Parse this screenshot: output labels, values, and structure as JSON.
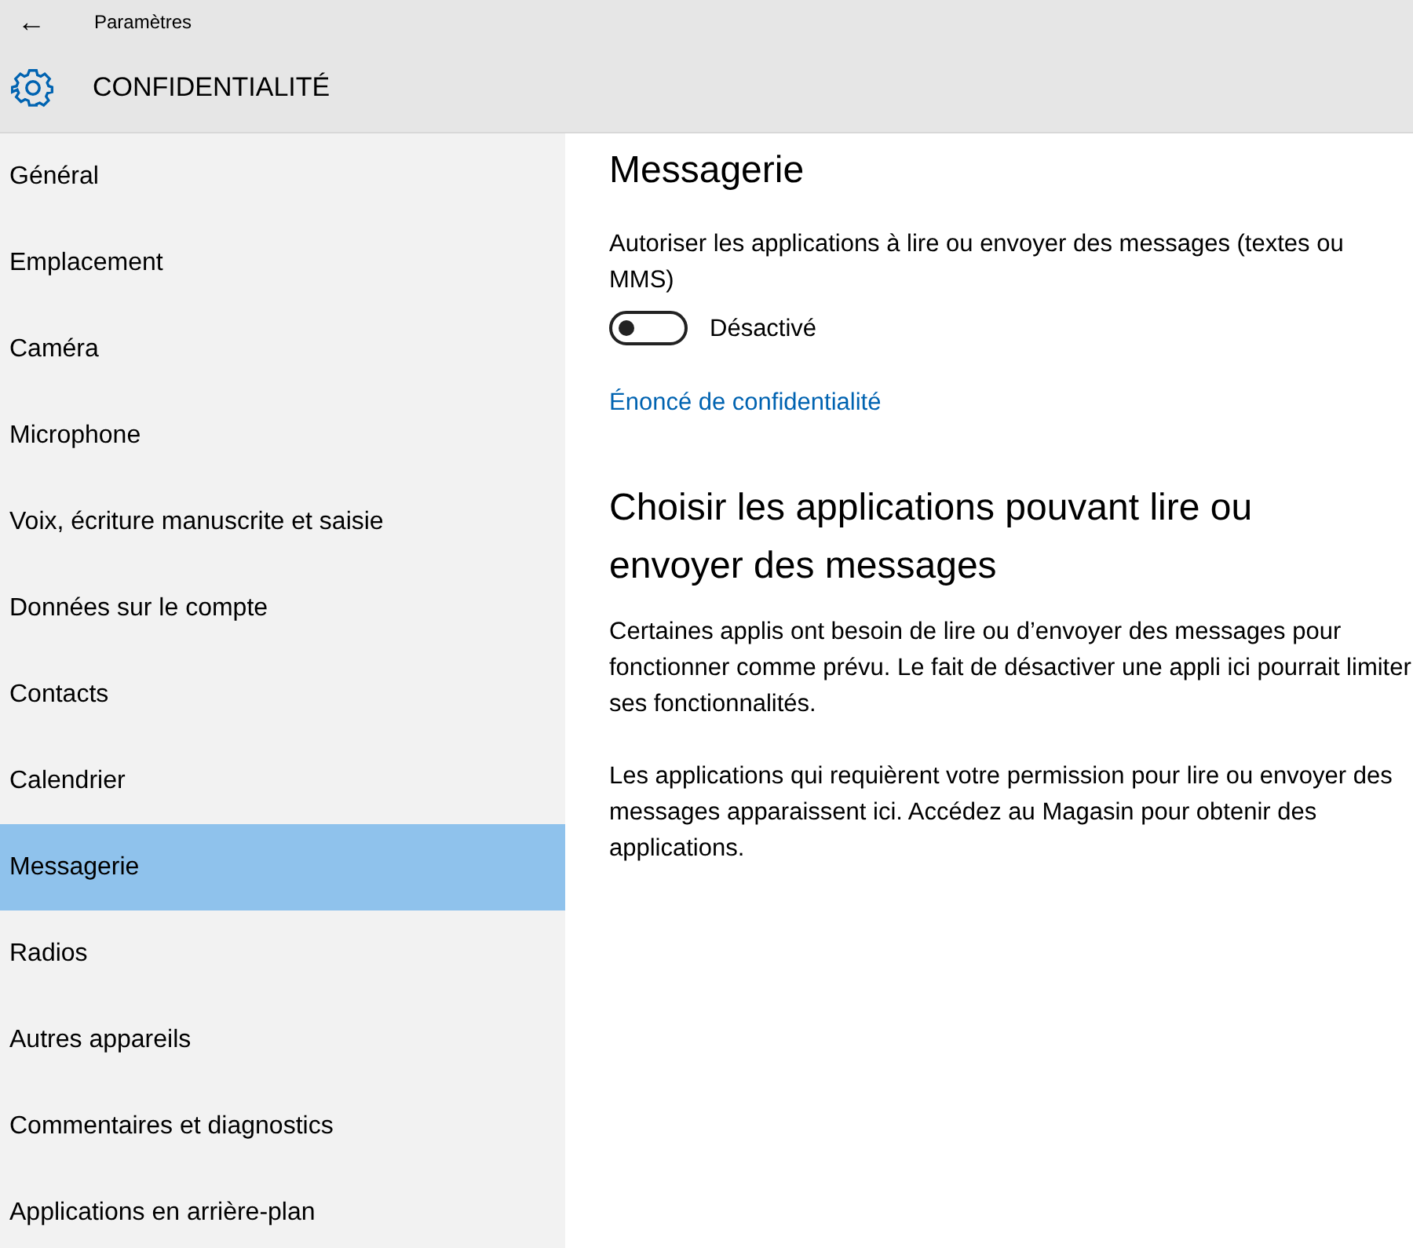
{
  "window": {
    "back_button": "←",
    "title": "Paramètres"
  },
  "header": {
    "title": "CONFIDENTIALITÉ"
  },
  "sidebar": {
    "items": [
      {
        "label": "Général",
        "selected": false
      },
      {
        "label": "Emplacement",
        "selected": false
      },
      {
        "label": "Caméra",
        "selected": false
      },
      {
        "label": "Microphone",
        "selected": false
      },
      {
        "label": "Voix, écriture manuscrite et saisie",
        "selected": false
      },
      {
        "label": "Données sur le compte",
        "selected": false
      },
      {
        "label": "Contacts",
        "selected": false
      },
      {
        "label": "Calendrier",
        "selected": false
      },
      {
        "label": "Messagerie",
        "selected": true
      },
      {
        "label": "Radios",
        "selected": false
      },
      {
        "label": "Autres appareils",
        "selected": false
      },
      {
        "label": "Commentaires et diagnostics",
        "selected": false
      },
      {
        "label": "Applications en arrière-plan",
        "selected": false
      }
    ]
  },
  "content": {
    "title": "Messagerie",
    "setting": {
      "description": "Autoriser les applications à lire ou envoyer des messages (textes ou MMS)",
      "on": false,
      "state_label": "Désactivé"
    },
    "link": "Énoncé de confidentialité",
    "section_title": "Choisir les applications pouvant lire ou envoyer des messages",
    "paragraphs": [
      "Certaines applis ont besoin de lire ou d’envoyer des messages pour fonctionner comme prévu. Le fait de désactiver une appli ici pourrait limiter ses fonctionnalités.",
      "Les applications qui requièrent votre permission pour lire ou envoyer des messages apparaissent ici. Accédez au Magasin pour obtenir des applications."
    ]
  }
}
